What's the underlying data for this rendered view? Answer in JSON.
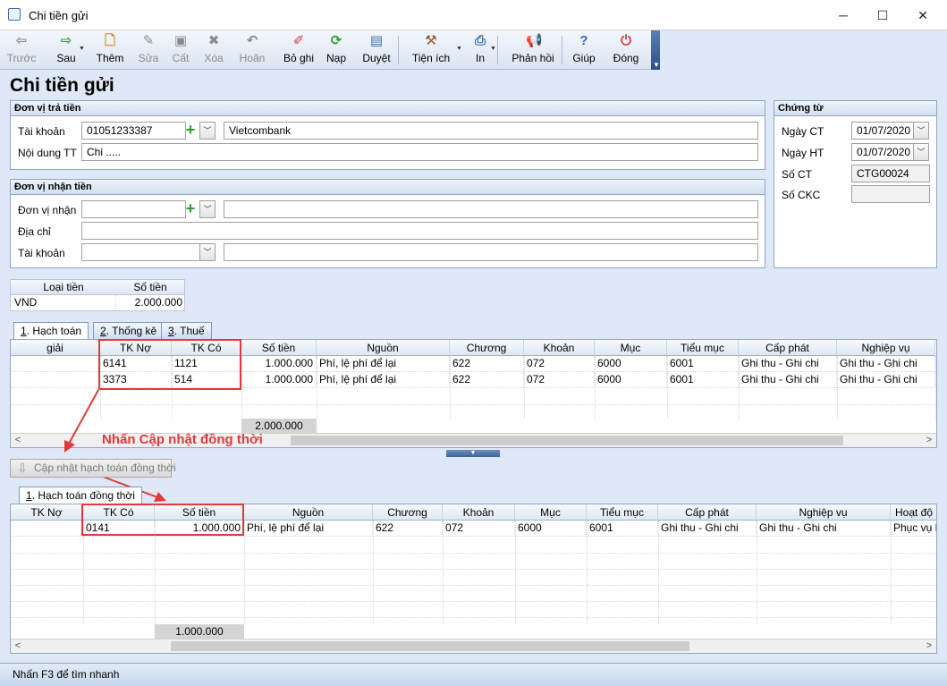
{
  "window": {
    "title": "Chi tiền gửi",
    "minimize": "─",
    "maximize": "☐",
    "close": "✕"
  },
  "toolbar": {
    "items": [
      {
        "label": "Trước",
        "icon": "arrow-left-icon",
        "glyph": "⇦",
        "color": "#8a8a8a"
      },
      {
        "label": "Sau",
        "icon": "arrow-right-icon",
        "glyph": "⇨",
        "color": "#2e9d2e"
      },
      {
        "label": "Thêm",
        "icon": "add-document-icon",
        "glyph": "🗋",
        "color": "#c48a14"
      },
      {
        "label": "Sửa",
        "icon": "edit-document-icon",
        "glyph": "✎",
        "color": "#8a8a8a"
      },
      {
        "label": "Cất",
        "icon": "save-disk-icon",
        "glyph": "▣",
        "color": "#8a8a8a"
      },
      {
        "label": "Xóa",
        "icon": "delete-document-icon",
        "glyph": "✖",
        "color": "#8a8a8a"
      },
      {
        "label": "Hoãn",
        "icon": "undo-icon",
        "glyph": "↶",
        "color": "#8a8a8a"
      },
      {
        "label": "Bỏ ghi",
        "icon": "unpost-pen-icon",
        "glyph": "✐",
        "color": "#d23b3b"
      },
      {
        "label": "Nạp",
        "icon": "reload-icon",
        "glyph": "⟳",
        "color": "#2e9d2e"
      },
      {
        "label": "Duyệt",
        "icon": "approve-document-icon",
        "glyph": "▤",
        "color": "#3a6fb0"
      },
      {
        "label": "Tiện ích",
        "icon": "tools-icon",
        "glyph": "⚒",
        "color": "#8a5a2a"
      },
      {
        "label": "In",
        "icon": "printer-icon",
        "glyph": "⎙",
        "color": "#3a6fb0"
      },
      {
        "label": "Phản hồi",
        "icon": "megaphone-icon",
        "glyph": "📢",
        "color": "#d2691e"
      },
      {
        "label": "Giúp",
        "icon": "help-icon",
        "glyph": "?",
        "color": "#2e6bc4"
      },
      {
        "label": "Đóng",
        "icon": "power-close-icon",
        "glyph": "⏻",
        "color": "#d23b3b"
      }
    ]
  },
  "page_title": "Chi tiền gửi",
  "payer": {
    "heading": "Đơn vị trả tiền",
    "account_label": "Tài khoản",
    "account_value": "01051233387",
    "bank_name": "Vietcombank",
    "content_label": "Nội dung TT",
    "content_value": "Chi ....."
  },
  "receiver": {
    "heading": "Đơn vị nhận tiền",
    "unit_label": "Đơn vị nhận",
    "unit_value": "",
    "address_label": "Địa chỉ",
    "address_value": "",
    "account_label": "Tài khoản",
    "account_value": ""
  },
  "voucher": {
    "heading": "Chứng từ",
    "date_ct_label": "Ngày CT",
    "date_ct_value": "01/07/2020",
    "date_ht_label": "Ngày HT",
    "date_ht_value": "01/07/2020",
    "number_label": "Số CT",
    "number_value": "CTG00024",
    "ckc_label": "Số CKC",
    "ckc_value": ""
  },
  "currency": {
    "col_type": "Loại tiền",
    "col_amount": "Số tiền",
    "type": "VND",
    "amount": "2.000.000"
  },
  "tabs": [
    {
      "num": "1",
      "text": ". Hạch toán"
    },
    {
      "num": "2",
      "text": ". Thống kê"
    },
    {
      "num": "3",
      "text": ". Thuế"
    }
  ],
  "grid1": {
    "headers": [
      "giải",
      "TK Nợ",
      "TK Có",
      "Số tiền",
      "Nguồn",
      "Chương",
      "Khoản",
      "Mục",
      "Tiểu mục",
      "Cấp phát",
      "Nghiệp vụ"
    ],
    "rows": [
      [
        "",
        "6141",
        "1121",
        "1.000.000",
        "Phí, lệ phí để lại",
        "622",
        "072",
        "6000",
        "6001",
        "Ghi thu - Ghi chi",
        "Ghi thu - Ghi chi"
      ],
      [
        "",
        "3373",
        "514",
        "1.000.000",
        "Phí, lệ phí để lại",
        "622",
        "072",
        "6000",
        "6001",
        "Ghi thu - Ghi chi",
        "Ghi thu - Ghi chi"
      ]
    ],
    "total": "2.000.000"
  },
  "annotation": "Nhấn Cập nhật đồng thời",
  "sync_button": "Cập nhật hạch toán đồng thời",
  "tab2": {
    "num": "1",
    "text": ". Hạch toán đồng thời"
  },
  "grid2": {
    "headers": [
      "TK Nợ",
      "TK Có",
      "Số tiền",
      "Nguồn",
      "Chương",
      "Khoản",
      "Mục",
      "Tiểu mục",
      "Cấp phát",
      "Nghiệp vụ",
      "Hoạt độ"
    ],
    "rows": [
      [
        "",
        "0141",
        "1.000.000",
        "Phí, lệ phí để lại",
        "622",
        "072",
        "6000",
        "6001",
        "Ghi thu - Ghi chi",
        "Ghi thu - Ghi chi",
        "Phục vụ h"
      ]
    ],
    "total": "1.000.000"
  },
  "statusbar": {
    "text": "Nhấn F3 để tìm nhanh"
  },
  "colors": {
    "accent": "#3a6fb0",
    "highlight": "#e03a3a",
    "panel_border": "#8fa6c6"
  }
}
